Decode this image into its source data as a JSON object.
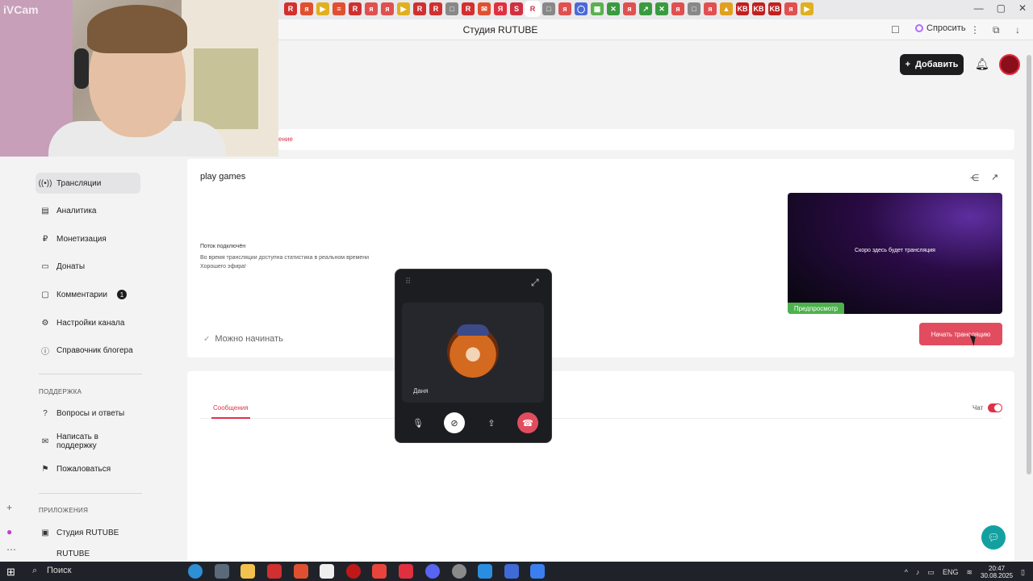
{
  "browser": {
    "page_title": "Студия RUTUBE",
    "ask_label": "Спросить",
    "tab_icons": [
      "R",
      "я",
      "▶",
      "≡",
      "R",
      "я",
      "я",
      "▶",
      "R",
      "R",
      "□",
      "R",
      "✉",
      "Я",
      "S",
      "R",
      "□",
      "я",
      "◯",
      "▦",
      "✕",
      "я",
      "↗",
      "✕",
      "я",
      "□",
      "я",
      "▲",
      "KB",
      "KB",
      "KB",
      "я",
      "▶"
    ]
  },
  "webcam": {
    "label": "iVCam"
  },
  "header": {
    "add_button_label": "Добавить",
    "add_icon": "plus-icon",
    "bell_icon": "bell-icon"
  },
  "tabs_row": {
    "partial_tab": "ение"
  },
  "sidebar": {
    "items": [
      {
        "label": "Трансляции",
        "icon": "broadcast-icon",
        "active": true
      },
      {
        "label": "Аналитика",
        "icon": "chart-icon"
      },
      {
        "label": "Монетизация",
        "icon": "ruble-icon"
      },
      {
        "label": "Донаты",
        "icon": "gift-icon"
      },
      {
        "label": "Комментарии",
        "icon": "comment-icon",
        "badge": "1"
      },
      {
        "label": "Настройки канала",
        "icon": "gear-icon"
      },
      {
        "label": "Справочник блогера",
        "icon": "info-icon"
      }
    ],
    "support_title": "ПОДДЕРЖКА",
    "support_items": [
      {
        "label": "Вопросы и ответы",
        "icon": "question-icon"
      },
      {
        "label": "Написать в поддержку",
        "icon": "mail-icon"
      },
      {
        "label": "Пожаловаться",
        "icon": "flag-icon"
      }
    ],
    "apps_title": "ПРИЛОЖЕНИЯ",
    "apps_items": [
      {
        "label": "Студия RUTUBE",
        "icon": "studio-icon"
      },
      {
        "label": "RUTUBE",
        "icon": "rutube-icon"
      }
    ]
  },
  "stream": {
    "title": "play games",
    "info_title": "Поток подключён",
    "info_lines": [
      "Во время трансляции доступна статистика в реальном времени",
      "Хорошего эфира!"
    ],
    "ready_label": "Можно начинать",
    "preview_text": "Скоро здесь будет трансляция",
    "preview_badge": "Предпросмотр",
    "start_button": "Начать трансляцию"
  },
  "chat": {
    "tab_label": "Сообщения",
    "toggle_label": "Чат",
    "toggle_on": true
  },
  "call": {
    "participant_name": "Даня"
  },
  "taskbar": {
    "search_label": "Поиск",
    "language": "ENG",
    "time": "20:47",
    "date": "30.08.2025"
  },
  "colors": {
    "accent": "#e0314b",
    "preview_green": "#4db24d",
    "dark": "#1d1d1f",
    "help_fab": "#14a0a0"
  }
}
